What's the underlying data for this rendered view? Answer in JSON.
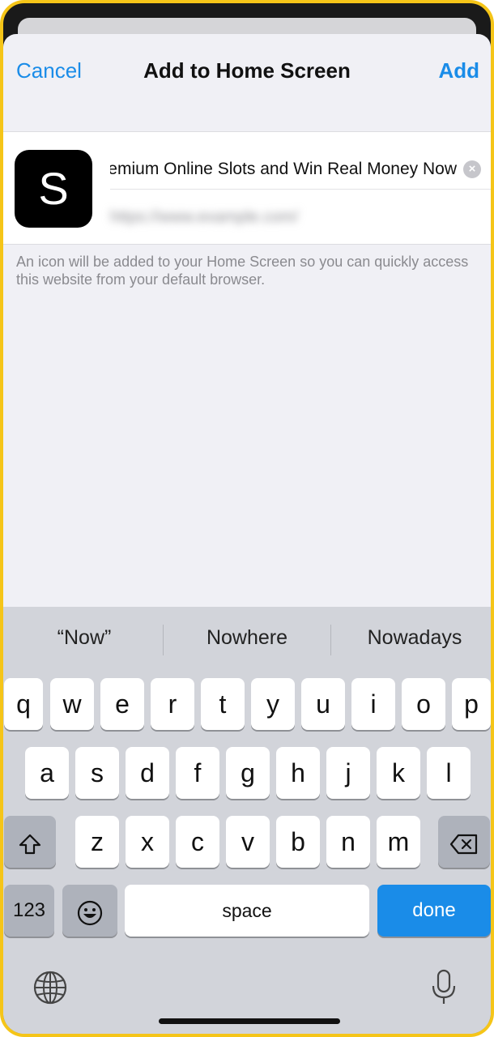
{
  "nav": {
    "cancel": "Cancel",
    "title": "Add to Home Screen",
    "add": "Add"
  },
  "shortcut": {
    "icon_letter": "S",
    "name_value": "Play Premium Online Slots and Win Real Money Now",
    "url_value": "https://www.example.com/",
    "clear_icon": "clear-circle-icon"
  },
  "hint": "An icon will be added to your Home Screen so you can quickly access this website from your default browser.",
  "keyboard": {
    "suggestions": [
      "“Now”",
      "Nowhere",
      "Nowadays"
    ],
    "row1": [
      "q",
      "w",
      "e",
      "r",
      "t",
      "y",
      "u",
      "i",
      "o",
      "p"
    ],
    "row2": [
      "a",
      "s",
      "d",
      "f",
      "g",
      "h",
      "j",
      "k",
      "l"
    ],
    "row3": [
      "z",
      "x",
      "c",
      "v",
      "b",
      "n",
      "m"
    ],
    "num_label": "123",
    "space_label": "space",
    "done_label": "done",
    "icons": [
      "shift-icon",
      "backspace-icon",
      "emoji-icon",
      "globe-icon",
      "microphone-icon"
    ]
  },
  "colors": {
    "accent": "#1a8ce8",
    "frame": "#f5c518",
    "keyboard_bg": "#d2d4da"
  }
}
